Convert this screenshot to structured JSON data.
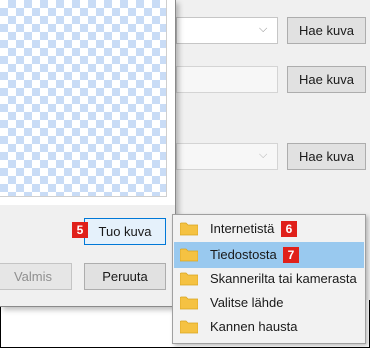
{
  "buttons": {
    "hae_kuva_1": "Hae kuva",
    "hae_kuva_2": "Hae kuva",
    "hae_kuva_3": "Hae kuva",
    "tuo_kuva": "Tuo kuva",
    "valmis": "Valmis",
    "peruuta": "Peruuta"
  },
  "badges": {
    "tuo_kuva": "5",
    "internetista": "6",
    "tiedostosta": "7"
  },
  "menu": {
    "items": [
      {
        "label": "Internetistä"
      },
      {
        "label": "Tiedostosta"
      },
      {
        "label": "Skannerilta tai kamerasta"
      },
      {
        "label": "Valitse lähde"
      },
      {
        "label": "Kannen hausta"
      }
    ]
  },
  "icons": {
    "combo_chevron": "chevron-down-icon",
    "menu_item": "folder-icon"
  },
  "colors": {
    "badge": "#e0201a",
    "menu_selected": "#99c9ef",
    "button_focus_border": "#0078d7",
    "folder": "#f5c242"
  }
}
